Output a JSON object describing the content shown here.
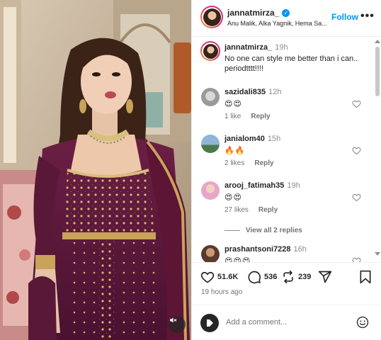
{
  "post": {
    "username": "jannatmirza_",
    "audio": "Anu Malik, Alka Yagnik, Hema Sa...",
    "follow_label": "Follow",
    "more_label": "•••"
  },
  "caption": {
    "username": "jannatmirza_",
    "time": "19h",
    "text": "No one can style me better than i can.. periodtttt!!!!"
  },
  "comments": [
    {
      "username": "sazidali835",
      "time": "12h",
      "emoji": "😍😍",
      "likes": "1 like",
      "reply": "Reply"
    },
    {
      "username": "janialom40",
      "time": "15h",
      "emoji": "🔥🔥",
      "likes": "2 likes",
      "reply": "Reply"
    },
    {
      "username": "arooj_fatimah35",
      "time": "19h",
      "emoji": "😍😍",
      "likes": "27 likes",
      "reply": "Reply",
      "view_replies": "View all 2 replies"
    },
    {
      "username": "prashantsoni7228",
      "time": "16h",
      "emoji": "😍😍😍"
    }
  ],
  "actions": {
    "likes": "51.6K",
    "comments": "536",
    "reposts": "239",
    "posted_ago": "19 hours ago"
  },
  "add_comment": {
    "placeholder": "Add a comment..."
  },
  "icons": [
    "verified-icon",
    "more-icon",
    "heart-icon",
    "comment-icon",
    "repost-icon",
    "share-icon",
    "bookmark-icon",
    "emoji-icon",
    "mute-icon"
  ],
  "colors": {
    "accent": "#0095f6",
    "text": "#262626",
    "muted": "#737373",
    "dress": "#5a1838",
    "gold": "#c9a35a"
  }
}
